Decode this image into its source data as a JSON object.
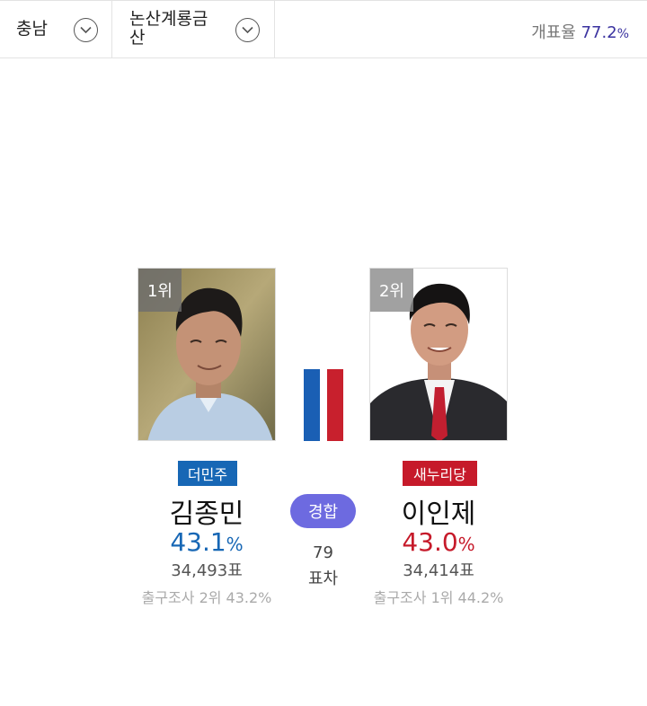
{
  "header": {
    "region": "충남",
    "district": "논산계룡금산",
    "count_rate_label": "개표율",
    "count_rate_value": "77.2",
    "count_rate_unit": "%"
  },
  "candidates": [
    {
      "rank": "1위",
      "party": "더민주",
      "party_color": "#1767b5",
      "name": "김종민",
      "rate": "43.1",
      "rate_unit": "%",
      "votes": "34,493표",
      "exit_poll": "출구조사 2위 43.2%"
    },
    {
      "rank": "2위",
      "party": "새누리당",
      "party_color": "#c61a2a",
      "name": "이인제",
      "rate": "43.0",
      "rate_unit": "%",
      "votes": "34,414표",
      "exit_poll": "출구조사 1위 44.2%"
    }
  ],
  "race": {
    "status": "경합",
    "gap": "79",
    "gap_unit": "표차"
  },
  "colors": {
    "accent": "#3b33a0",
    "status_badge": "#6d6ae0",
    "bar_left": "#1a5fb4",
    "bar_right": "#c8202d"
  },
  "icons": {
    "region_dropdown": "chevron-down-icon",
    "district_dropdown": "chevron-down-icon"
  }
}
